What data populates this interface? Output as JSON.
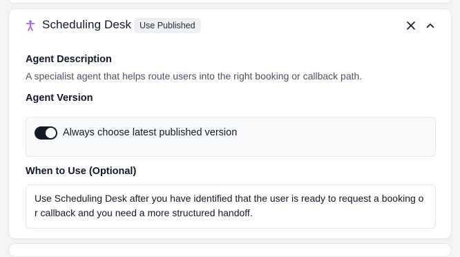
{
  "agent": {
    "name": "Scheduling Desk",
    "badge": "Use Published",
    "accent_color": "#a855f7"
  },
  "header": {
    "close_icon": "close-icon",
    "collapse_icon": "chevron-up-icon"
  },
  "description": {
    "label": "Agent Description",
    "text": "A specialist agent that helps route users into the right booking or callback path."
  },
  "version": {
    "label": "Agent Version",
    "toggle_label": "Always choose latest published version",
    "toggle_on": true
  },
  "when_to_use": {
    "label": "When to Use (Optional)",
    "value": "Use Scheduling Desk after you have identified that the user is ready to request a booking or callback and you need a more structured handoff."
  }
}
